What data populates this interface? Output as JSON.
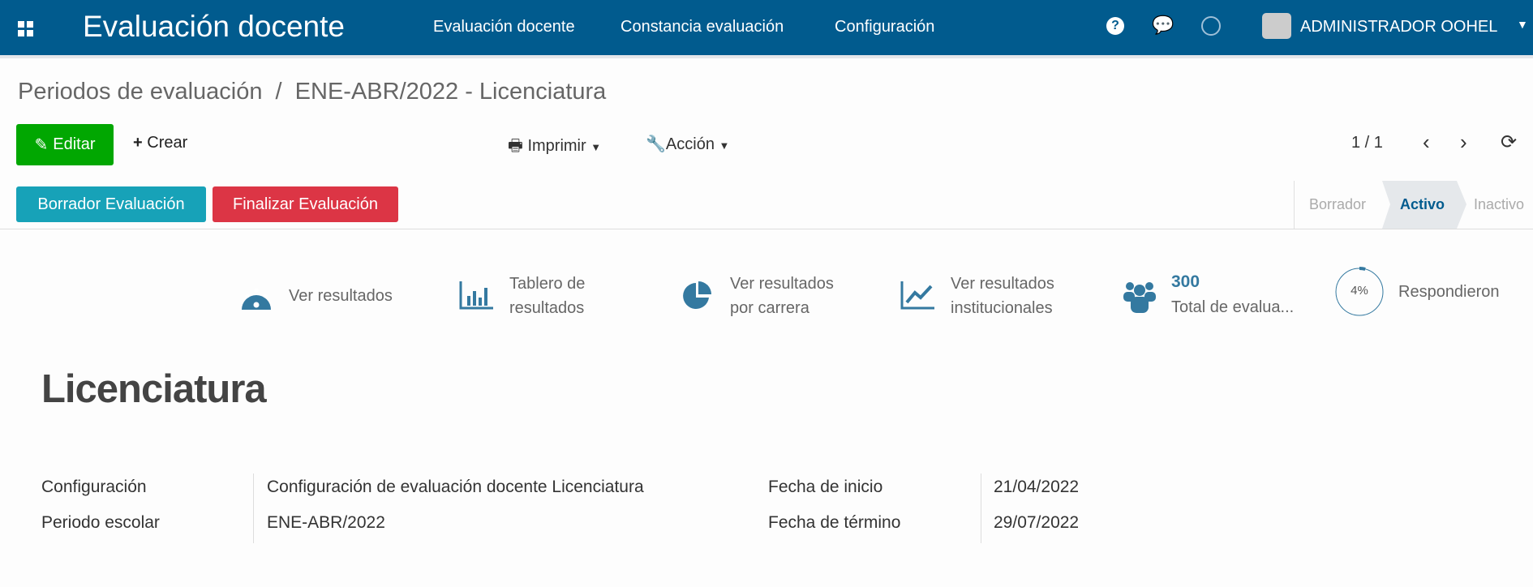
{
  "navbar": {
    "app_title": "Evaluación docente",
    "menu": [
      "Evaluación docente",
      "Constancia evaluación",
      "Configuración"
    ],
    "user": "ADMINISTRADOR OOHEL",
    "color": "#015b8e"
  },
  "breadcrumb": {
    "parent": "Periodos de evaluación",
    "separator": "/",
    "current": "ENE-ABR/2022 - Licenciatura"
  },
  "toolbar": {
    "edit": "Editar",
    "create": "Crear",
    "print": "Imprimir",
    "action": "Acción",
    "pager": "1 / 1"
  },
  "header_buttons": {
    "draft": "Borrador Evaluación",
    "finish": "Finalizar Evaluación"
  },
  "statusbar": {
    "states": [
      "Borrador",
      "Activo",
      "Inactivo"
    ],
    "active": "Activo"
  },
  "stats": {
    "results": "Ver resultados",
    "dashboard": [
      "Tablero de",
      "resultados"
    ],
    "by_career": [
      "Ver resultados",
      "por carrera"
    ],
    "institutional": [
      "Ver resultados",
      "institucionales"
    ],
    "total_value": "300",
    "total_label": "Total de evalua...",
    "percent": "4%",
    "percent_value": 4,
    "percent_label": "Respondieron"
  },
  "record": {
    "title": "Licenciatura",
    "fields": {
      "config_label": "Configuración",
      "config_value": "Configuración de evaluación docente Licenciatura",
      "period_label": "Periodo escolar",
      "period_value": "ENE-ABR/2022",
      "start_label": "Fecha de inicio",
      "start_value": "21/04/2022",
      "end_label": "Fecha de término",
      "end_value": "29/07/2022"
    }
  }
}
